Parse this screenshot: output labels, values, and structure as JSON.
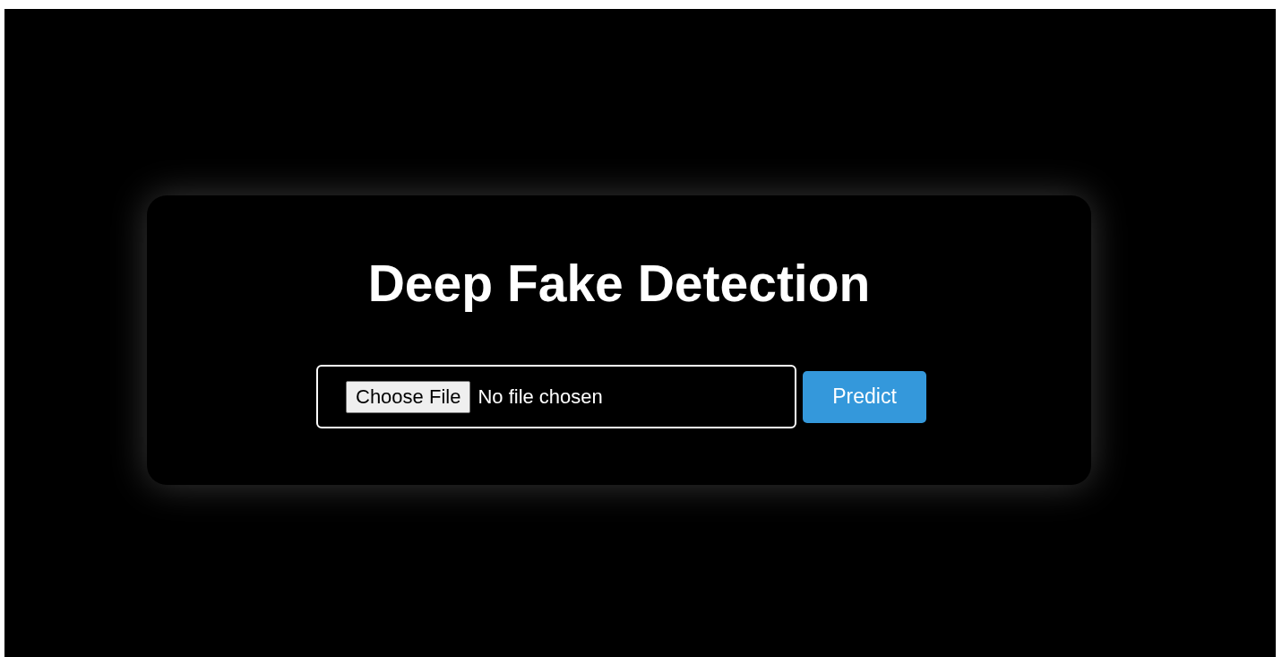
{
  "title": "Deep Fake Detection",
  "file_input": {
    "button_label": "Choose File",
    "status": "No file chosen"
  },
  "predict_button": {
    "label": "Predict"
  }
}
